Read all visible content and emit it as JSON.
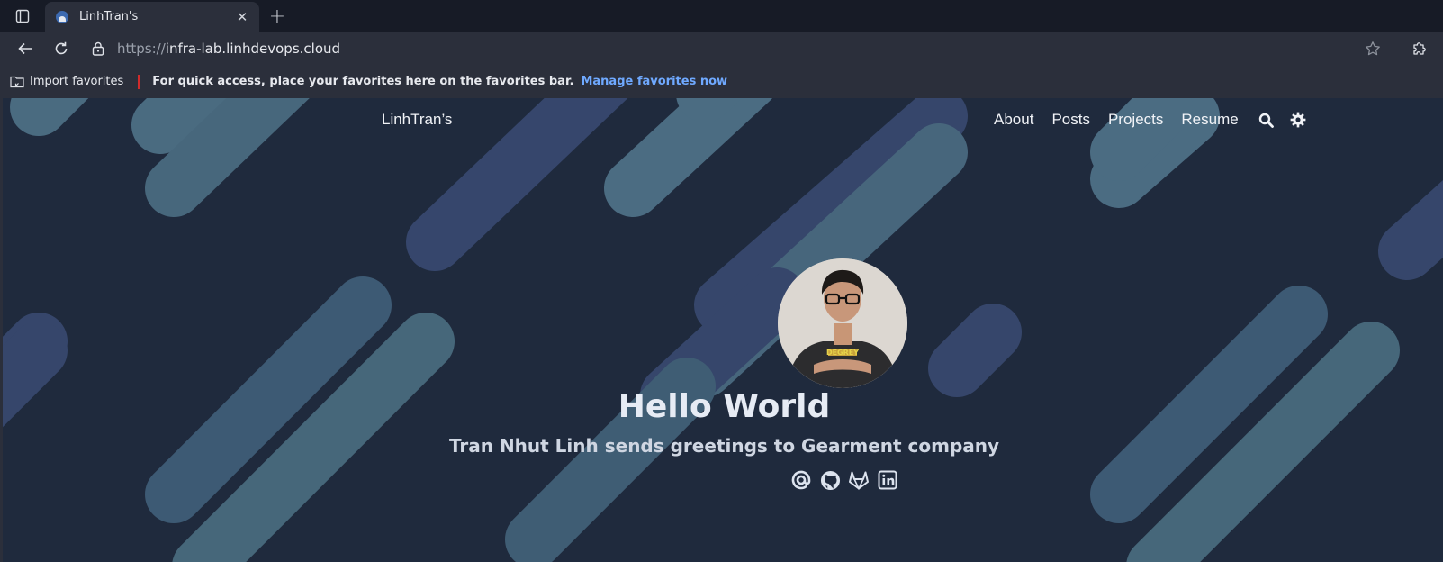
{
  "browser": {
    "tab_title": "LinhTran's",
    "url_proto": "https://",
    "url_host": "infra-lab.linhdevops.cloud",
    "favorites_import": "Import favorites",
    "favorites_hint": "For quick access, place your favorites here on the favorites bar.",
    "favorites_link": "Manage favorites now",
    "icons": [
      "tab-actions-icon",
      "favicon-icon",
      "close-icon",
      "plus-icon",
      "back-arrow-icon",
      "refresh-icon",
      "lock-icon",
      "star-icon",
      "extensions-icon",
      "import-folder-icon"
    ]
  },
  "site": {
    "title": "LinhTran’s",
    "nav": [
      "About",
      "Posts",
      "Projects",
      "Resume"
    ],
    "nav_icons": [
      "search-icon",
      "theme-gear-icon"
    ]
  },
  "hero": {
    "title": "Hello World",
    "subtitle": "Tran Nhut Linh sends greetings to Gearment company",
    "socials": [
      "email-at-icon",
      "github-icon",
      "gitlab-icon",
      "linkedin-icon"
    ]
  },
  "colors": {
    "page_bg": "#1f2a3d",
    "stripe_teal": "#3f6275",
    "stripe_blue": "#34436a",
    "text": "#e6ebf4"
  }
}
